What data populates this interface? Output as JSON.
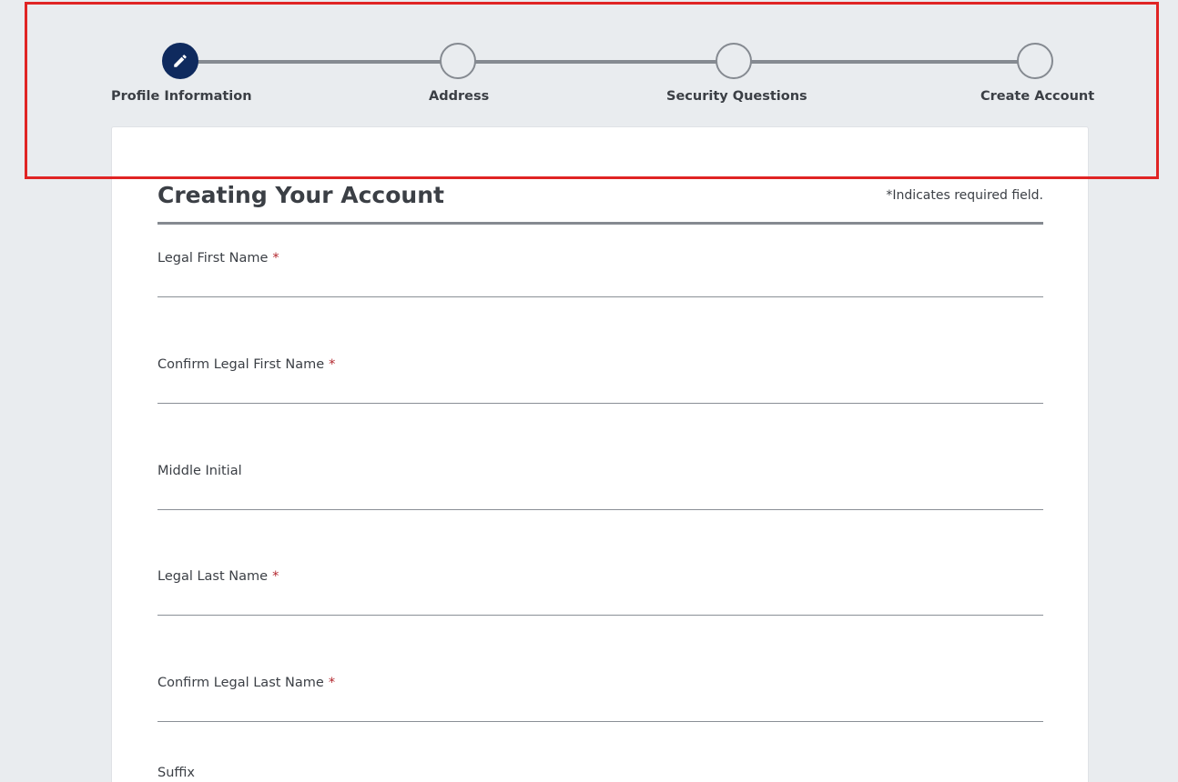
{
  "stepper": {
    "steps": [
      {
        "label": "Profile Information",
        "state": "active",
        "icon": "pencil-icon"
      },
      {
        "label": "Address",
        "state": "pending"
      },
      {
        "label": "Security Questions",
        "state": "pending"
      },
      {
        "label": "Create Account",
        "state": "pending"
      }
    ]
  },
  "form": {
    "title": "Creating Your Account",
    "required_note": "*Indicates required field.",
    "required_marker": "*",
    "fields": [
      {
        "label": "Legal First Name",
        "required": true,
        "value": ""
      },
      {
        "label": "Confirm Legal First Name",
        "required": true,
        "value": ""
      },
      {
        "label": "Middle Initial",
        "required": false,
        "value": ""
      },
      {
        "label": "Legal Last Name",
        "required": true,
        "value": ""
      },
      {
        "label": "Confirm Legal Last Name",
        "required": true,
        "value": ""
      },
      {
        "label": "Suffix",
        "required": false,
        "value": ""
      }
    ]
  },
  "colors": {
    "background": "#e9ecef",
    "active_step": "#0f2a5e",
    "step_line": "#858a91",
    "required_star": "#b3272e",
    "highlight_border": "#e02424"
  }
}
